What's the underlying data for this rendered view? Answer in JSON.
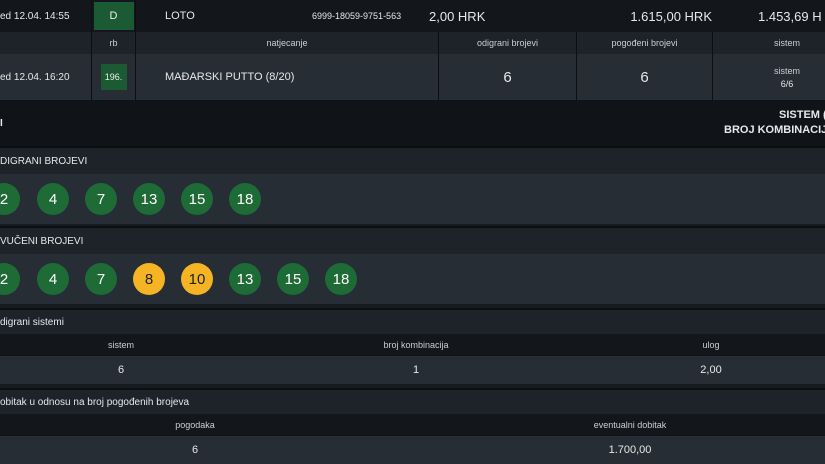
{
  "ticket": {
    "date": "ed 12.04. 14:55",
    "status": "D",
    "game": "LOTO",
    "code": "6999-18059-9751-563",
    "stake": "2,00 HRK",
    "payout": "1.615,00 HRK",
    "net": "1.453,69 H"
  },
  "headers": {
    "rb": "rb",
    "event": "natjecanje",
    "played": "odigrani brojevi",
    "hit": "pogođeni brojevi",
    "system": "sistem"
  },
  "event_row": {
    "date": "ed 12.04. 16:20",
    "rb": "196.",
    "name": "MAĐARSKI PUTTO (8/20)",
    "played": "6",
    "hit": "6",
    "system_label": "sistem",
    "system_value": "6/6"
  },
  "summary": {
    "left_fragment": "I",
    "system": "SISTEM (",
    "combinations": "BROJ KOMBINACIJ"
  },
  "played_numbers": {
    "title": "DIGRANI BROJEVI",
    "balls": [
      "2",
      "4",
      "7",
      "13",
      "15",
      "18"
    ]
  },
  "drawn_numbers": {
    "title": "VUČENI BROJEVI",
    "balls": [
      {
        "n": "2",
        "color": "#1f6b35"
      },
      {
        "n": "4",
        "color": "#1f6b35"
      },
      {
        "n": "7",
        "color": "#1f6b35"
      },
      {
        "n": "8",
        "color": "#f4b423"
      },
      {
        "n": "10",
        "color": "#f4b423"
      },
      {
        "n": "13",
        "color": "#1f6b35"
      },
      {
        "n": "15",
        "color": "#1f6b35"
      },
      {
        "n": "18",
        "color": "#1f6b35"
      }
    ]
  },
  "systems": {
    "title": "digrani sistemi",
    "col_system": "sistem",
    "col_combinations": "broj kombinacija",
    "col_stake": "ulog",
    "system": "6",
    "combinations": "1",
    "stake": "2,00"
  },
  "winnings": {
    "title": "obitak u odnosu na broj pogođenih brojeva",
    "col_hits": "pogodaka",
    "col_win": "eventualni dobitak",
    "hits": "6",
    "win": "1.700,00"
  },
  "colors": {
    "green_ball": "#1f6b35",
    "yellow_ball": "#f4b423",
    "status_chip": "#1c5a33"
  }
}
